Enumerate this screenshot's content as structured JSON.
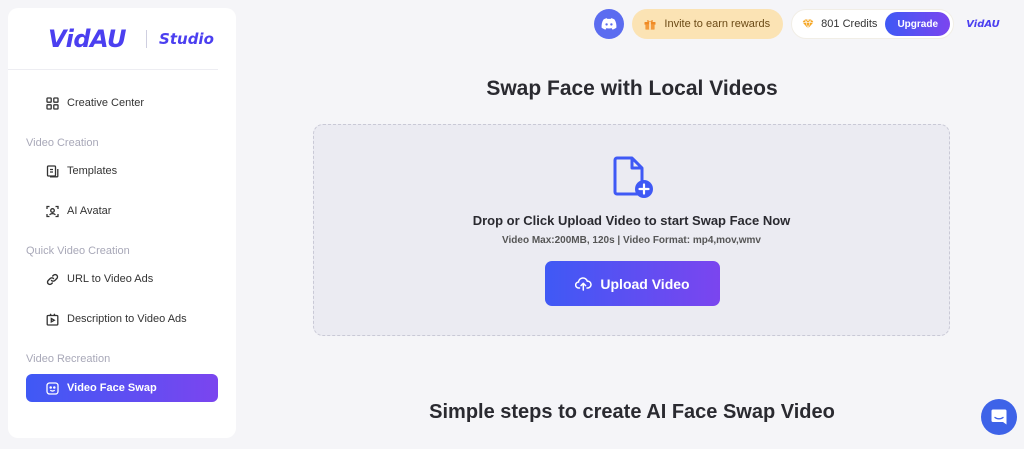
{
  "brand": {
    "logo": "VidAU",
    "product": "Studio"
  },
  "topbar": {
    "discord_icon": "discord-icon",
    "invite_label": "Invite to earn rewards",
    "credits_label": "801 Credits",
    "upgrade_label": "Upgrade",
    "account_logo": "VidAU"
  },
  "sidebar": {
    "items": [
      {
        "label": "Creative Center",
        "icon": "grid-icon"
      },
      {
        "section": "Video Creation"
      },
      {
        "label": "Templates",
        "icon": "template-icon"
      },
      {
        "label": "AI Avatar",
        "icon": "avatar-scan-icon"
      },
      {
        "section": "Quick Video Creation"
      },
      {
        "label": "URL to Video Ads",
        "icon": "link-icon"
      },
      {
        "label": "Description to Video Ads",
        "icon": "video-file-icon"
      },
      {
        "section": "Video Recreation"
      },
      {
        "label": "Video Face Swap",
        "icon": "face-swap-icon",
        "active": true
      }
    ]
  },
  "main": {
    "title": "Swap Face with Local Videos",
    "dropzone": {
      "heading": "Drop or Click Upload Video to start Swap Face Now",
      "requirements": "Video Max:200MB, 120s | Video Format: mp4,mov,wmv",
      "upload_label": "Upload Video"
    },
    "steps_title": "Simple steps to create AI Face Swap Video"
  },
  "colors": {
    "accent": "#4b3ff0",
    "gradient_start": "#3f59f5",
    "gradient_end": "#7b45ef",
    "discord": "#5b6cf0",
    "invite_bg": "#fbe3b4",
    "chat": "#3e63e8"
  }
}
